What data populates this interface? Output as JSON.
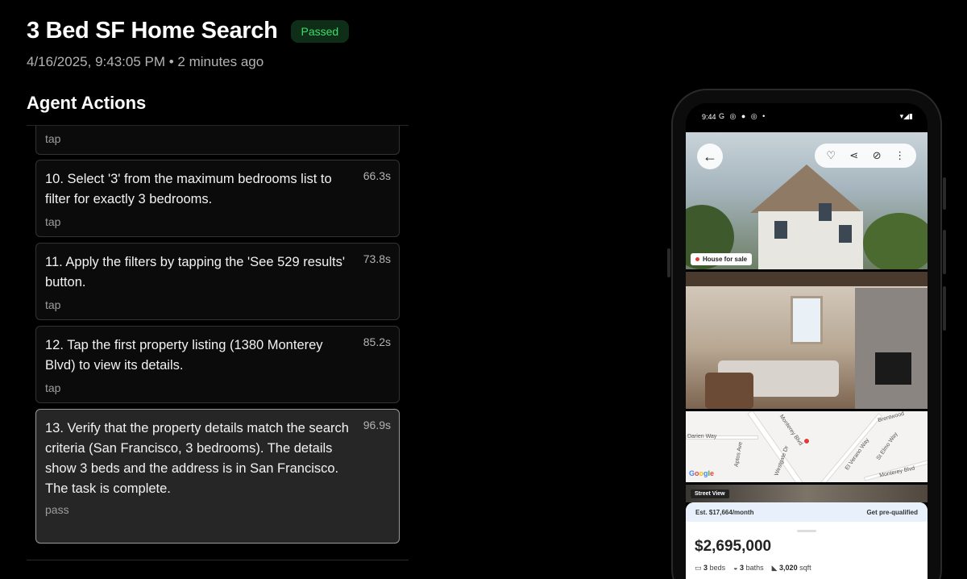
{
  "header": {
    "title": "3 Bed SF Home Search",
    "status_badge": "Passed",
    "timestamp": "4/16/2025, 9:43:05 PM • 2 minutes ago"
  },
  "actions_section": {
    "title": "Agent Actions",
    "items": [
      {
        "text": "",
        "time": "",
        "type": "tap"
      },
      {
        "text": "10. Select '3' from the maximum bedrooms list to filter for exactly 3 bedrooms.",
        "time": "66.3s",
        "type": "tap"
      },
      {
        "text": "11. Apply the filters by tapping the 'See 529 results' button.",
        "time": "73.8s",
        "type": "tap"
      },
      {
        "text": "12. Tap the first property listing (1380 Monterey Blvd) to view its details.",
        "time": "85.2s",
        "type": "tap"
      },
      {
        "text": "13. Verify that the property details match the search criteria (San Francisco, 3 bedrooms). The details show 3 beds and the address is in San Francisco. The task is complete.",
        "time": "96.9s",
        "type": "pass"
      }
    ]
  },
  "phone": {
    "status_time": "9:44",
    "status_icons": "G ◎ ● ◎ •",
    "status_right": "▾◢▮",
    "listing": {
      "house_tag": "House for sale",
      "street_view": "Street View",
      "est_payment": "Est. $17,664/month",
      "prequalify": "Get pre-qualified",
      "price": "$2,695,000",
      "beds": "3",
      "beds_label": "beds",
      "baths": "3",
      "baths_label": "baths",
      "sqft": "3,020",
      "sqft_label": "sqft"
    },
    "map_labels": {
      "monterey": "Monterey Blvd",
      "monterey2": "Monterey Blvd",
      "darien": "Darien Way",
      "aptos": "Aptos Ave",
      "westgate": "Westgate Dr",
      "elverano": "El Verano Way",
      "stelmo": "St Elmo Way",
      "brentwood": "Brentwood"
    }
  },
  "colors": {
    "badge_bg": "#0f2e18",
    "badge_text": "#3ddc6a",
    "active_card_border": "#9a9a9a"
  }
}
